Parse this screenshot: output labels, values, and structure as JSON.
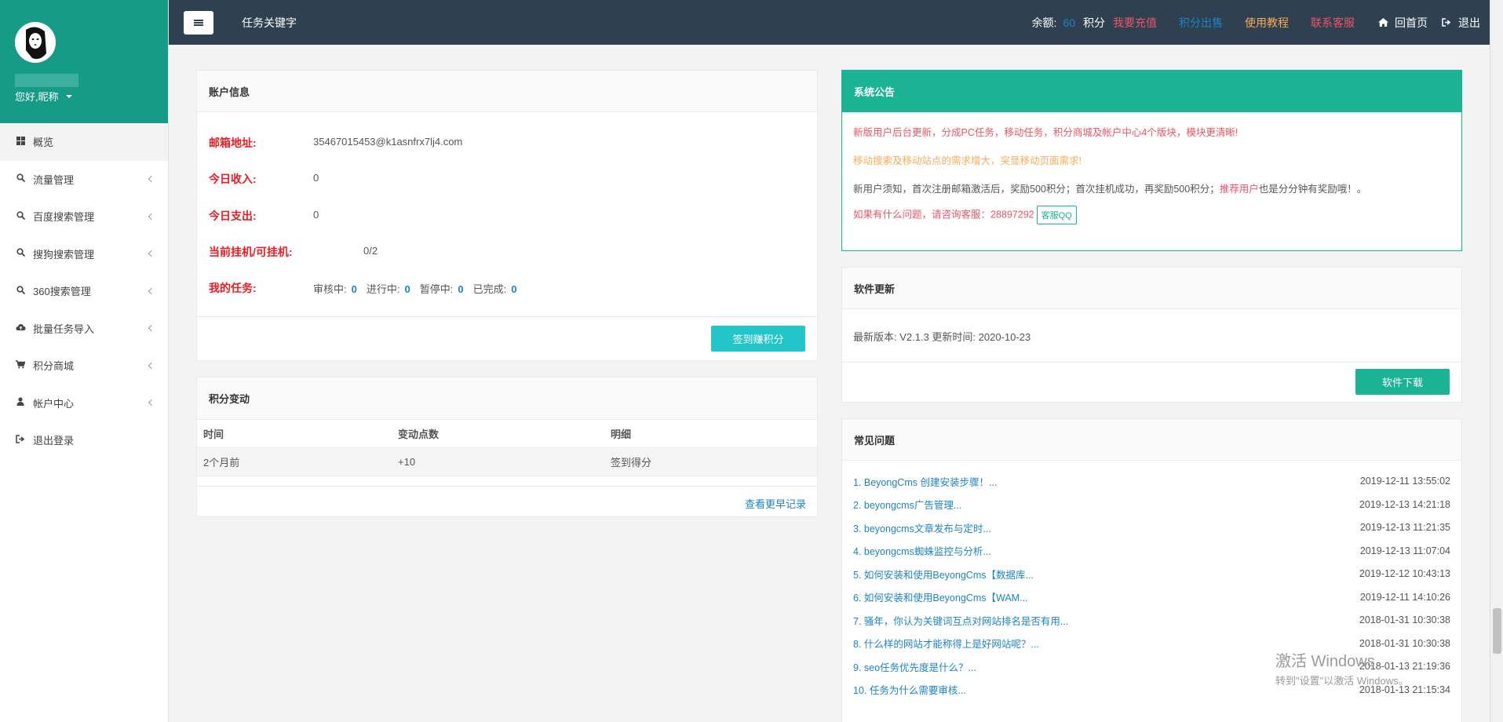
{
  "sidebar": {
    "greeting": "您好,昵称",
    "items": [
      {
        "label": "概览",
        "icon": "grid-icon"
      },
      {
        "label": "流量管理",
        "icon": "search-icon"
      },
      {
        "label": "百度搜索管理",
        "icon": "search-icon"
      },
      {
        "label": "搜狗搜索管理",
        "icon": "search-icon"
      },
      {
        "label": "360搜索管理",
        "icon": "search-icon"
      },
      {
        "label": "批量任务导入",
        "icon": "cloud-upload-icon"
      },
      {
        "label": "积分商城",
        "icon": "cart-icon"
      },
      {
        "label": "帐户中心",
        "icon": "user-icon"
      },
      {
        "label": "退出登录",
        "icon": "sign-out-icon"
      }
    ]
  },
  "topbar": {
    "title": "任务关键字",
    "balance_label": "余额:",
    "balance_value": "60",
    "points_label": "积分",
    "recharge": "我要充值",
    "sell_points": "积分出售",
    "tutorial": "使用教程",
    "contact": "联系客服",
    "home": "回首页",
    "logout": "退出"
  },
  "account": {
    "title": "账户信息",
    "email_label": "邮箱地址:",
    "email_value": "35467015453@k1asnfrx7lj4.com",
    "income_label": "今日收入:",
    "income_value": "0",
    "expense_label": "今日支出:",
    "expense_value": "0",
    "hang_label": "当前挂机/可挂机:",
    "hang_value": "0/2",
    "tasks_label": "我的任务:",
    "tasks": {
      "review_label": "审核中:",
      "review_value": "0",
      "running_label": "进行中:",
      "running_value": "0",
      "paused_label": "暂停中:",
      "paused_value": "0",
      "done_label": "已完成:",
      "done_value": "0"
    },
    "signin_button": "签到赚积分"
  },
  "points": {
    "title": "积分变动",
    "headers": [
      "时间",
      "变动点数",
      "明细"
    ],
    "rows": [
      [
        "2个月前",
        "+10",
        "签到得分"
      ]
    ],
    "more_link": "查看更早记录"
  },
  "notice": {
    "title": "系统公告",
    "line1": "新版用户后台更新，分成PC任务，移动任务，积分商城及帐户中心4个版块，模块更清晰!",
    "line2": "移动搜索及移动站点的需求增大，突显移动页面需求!",
    "line3_a": "新用户须知，首次注册邮箱激活后，奖励500积分；首次挂机成功，再奖励500积分；",
    "line3_link": "推荐用户",
    "line3_b": "也是分分钟有奖励哦！。",
    "line4": "如果有什么问题，请咨询客服：28897292",
    "qq_button": "客服QQ",
    "colors": {
      "red": "#ed5565",
      "orange": "#f8ac59"
    }
  },
  "software": {
    "title": "软件更新",
    "version_text": "最新版本: V2.1.3 更新时间: 2020-10-23",
    "download_button": "软件下载"
  },
  "faq": {
    "title": "常见问题",
    "items": [
      {
        "q": "1. BeyongCms 创建安装步骤！...",
        "d": "2019-12-11 13:55:02"
      },
      {
        "q": "2. beyongcms广告管理...",
        "d": "2019-12-13 14:21:18"
      },
      {
        "q": "3. beyongcms文章发布与定时...",
        "d": "2019-12-13 11:21:35"
      },
      {
        "q": "4. beyongcms蜘蛛监控与分析...",
        "d": "2019-12-13 11:07:04"
      },
      {
        "q": "5. 如何安装和使用BeyongCms【数据库...",
        "d": "2019-12-12 10:43:13"
      },
      {
        "q": "6. 如何安装和使用BeyongCms【WAM...",
        "d": "2019-12-11 14:10:26"
      },
      {
        "q": "7. 骚年，你认为关键词互点对网站排名是否有用...",
        "d": "2018-01-31 10:30:38"
      },
      {
        "q": "8. 什么样的网站才能称得上是好网站呢？...",
        "d": "2018-01-31 10:30:38"
      },
      {
        "q": "9. seo任务优先度是什么？...",
        "d": "2018-01-13 21:19:36"
      },
      {
        "q": "10. 任务为什么需要审核...",
        "d": "2018-01-13 21:15:34"
      }
    ]
  },
  "watermark": {
    "line1": "激活 Windows",
    "line2": "转到\"设置\"以激活 Windows。"
  }
}
